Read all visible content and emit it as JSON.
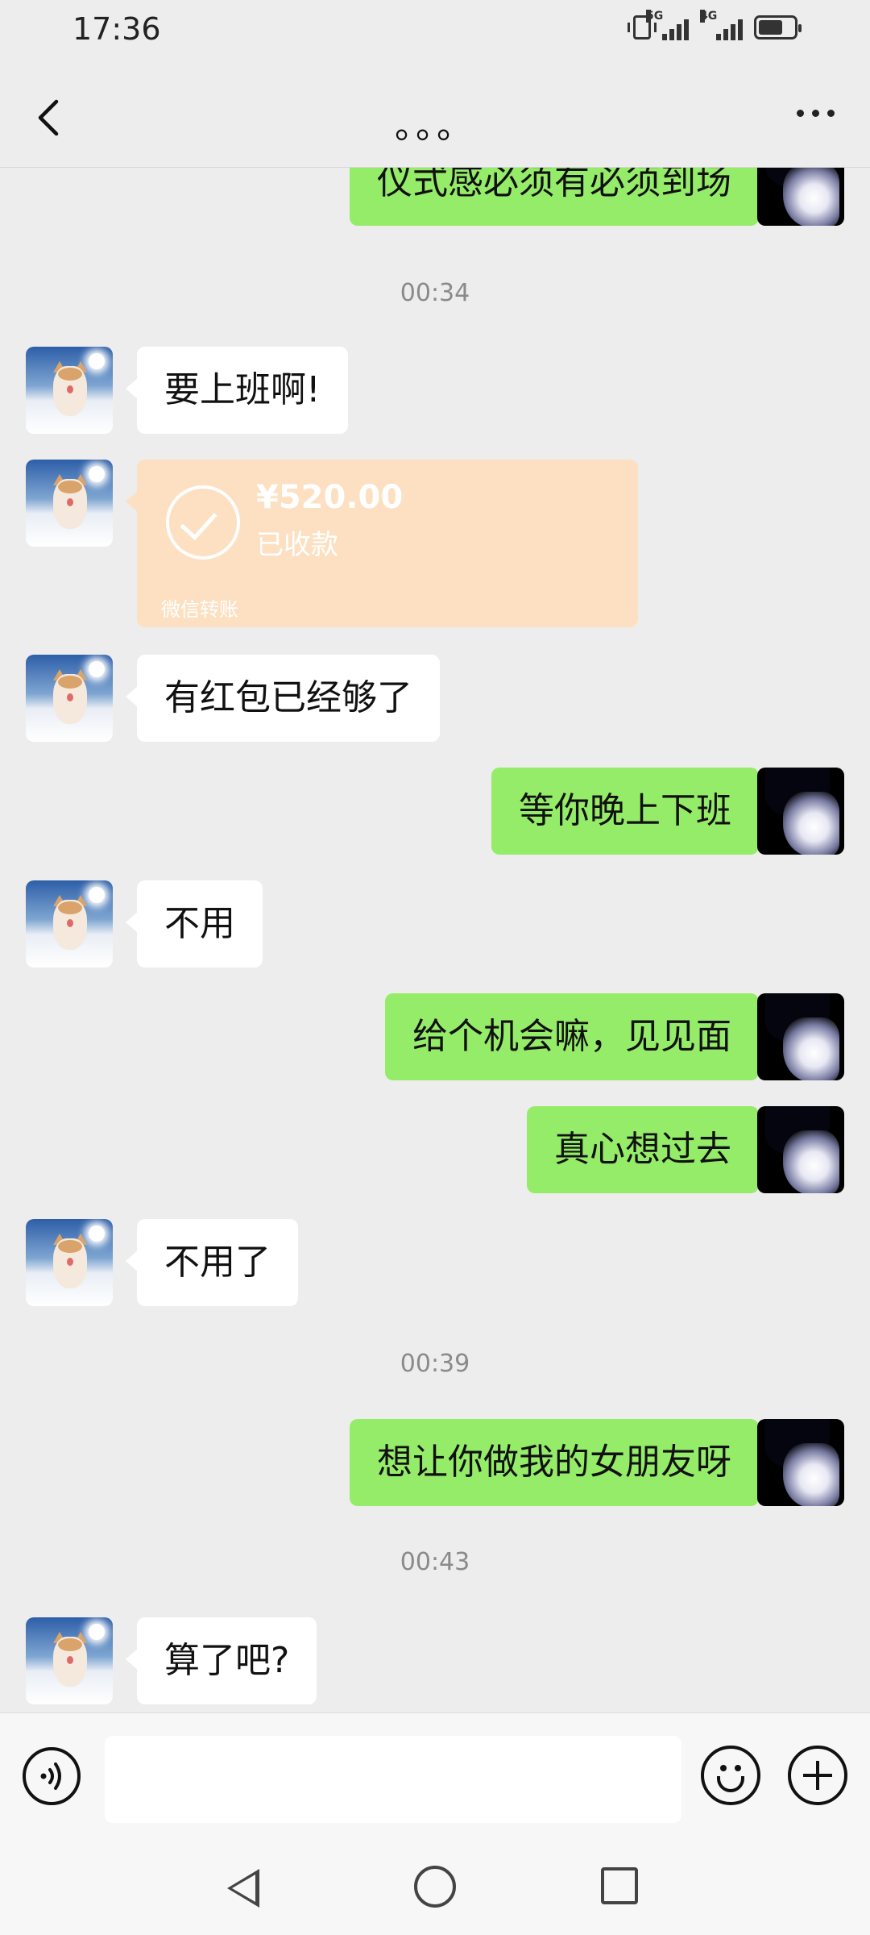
{
  "status_bar": {
    "time": "17:36",
    "network_1": "5G",
    "network_2": "4G"
  },
  "header": {
    "title": "。。。"
  },
  "messages": {
    "m0": "仪式感必须有必须到场",
    "t1": "00:34",
    "m1": "要上班啊!",
    "transfer": {
      "amount": "¥520.00",
      "status": "已收款",
      "label": "微信转账"
    },
    "m3": "有红包已经够了",
    "m4": "等你晚上下班",
    "m5": "不用",
    "m6": "给个机会嘛，见见面",
    "m7": "真心想过去",
    "m8": "不用了",
    "t2": "00:39",
    "m9": "想让你做我的女朋友呀",
    "t3": "00:43",
    "m10": "算了吧?"
  },
  "input": {
    "value": ""
  },
  "colors": {
    "outgoing_bubble": "#95ec69",
    "incoming_bubble": "#ffffff",
    "transfer_card": "#fde0c1",
    "background": "#ededed"
  }
}
